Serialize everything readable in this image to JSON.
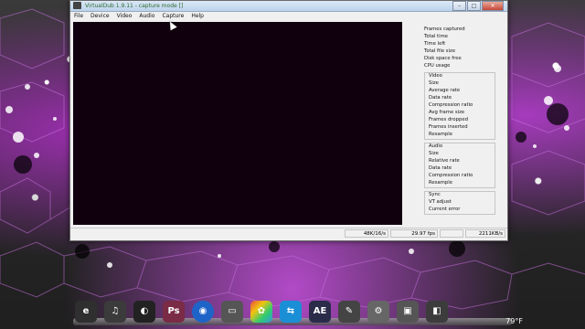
{
  "window": {
    "title": "VirtualDub 1.9.11 - capture mode []",
    "buttons": {
      "minimize": "–",
      "maximize": "□",
      "close": "✕"
    }
  },
  "menu": [
    "File",
    "Device",
    "Video",
    "Audio",
    "Capture",
    "Help"
  ],
  "stats": {
    "top": [
      "Frames captured",
      "Total time",
      "Time left",
      "Total file size",
      "Disk space free",
      "CPU usage"
    ],
    "video": {
      "title": "Video",
      "items": [
        "Size",
        "Average rate",
        "Data rate",
        "Compression ratio",
        "Avg frame size",
        "Frames dropped",
        "Frames inserted",
        "Resample"
      ]
    },
    "audio": {
      "title": "Audio",
      "items": [
        "Size",
        "Relative rate",
        "Data rate",
        "Compression ratio",
        "Resample"
      ]
    },
    "sync": {
      "title": "Sync",
      "items": [
        "VT adjust",
        "Current error"
      ]
    }
  },
  "statusbar": {
    "audio_format": "48K/16/s",
    "fps": "29.97 fps",
    "blank": "",
    "data_rate": "2211KB/s"
  },
  "taskbar": {
    "clock": "79°F",
    "icons": [
      "e",
      "♫",
      "◐",
      "Ps",
      "◉",
      "▭",
      "✿",
      "⇆",
      "AE",
      "✎",
      "⚙",
      "▣",
      "◧"
    ]
  },
  "colors": {
    "accent": "#b24ac8",
    "video_bg": "#10000d"
  }
}
